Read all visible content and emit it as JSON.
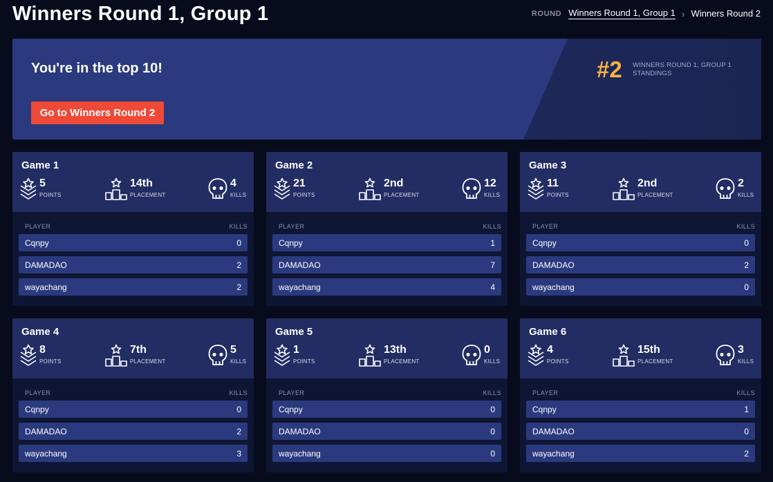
{
  "header": {
    "title": "Winners Round 1, Group 1",
    "breadcrumb_label": "ROUND",
    "breadcrumb_current": "Winners Round 1, Group 1",
    "breadcrumb_next": "Winners Round 2"
  },
  "banner": {
    "title": "You're in the top 10!",
    "button_label": "Go to Winners Round 2",
    "rank": "#2",
    "rank_caption": "WINNERS ROUND 1, GROUP 1 STANDINGS",
    "rank_color": "#f6b343",
    "button_color": "#ef4a38"
  },
  "table_headers": {
    "player": "PLAYER",
    "kills": "KILLS"
  },
  "stat_labels": {
    "points": "POINTS",
    "placement": "PLACEMENT",
    "kills": "KILLS"
  },
  "icons": {
    "points": "chevron-star-icon",
    "placement": "podium-icon",
    "kills": "skull-icon"
  },
  "games": [
    {
      "title": "Game 1",
      "points": "5",
      "placement": "14th",
      "kills": "4",
      "players": [
        {
          "name": "Cqnpy",
          "kills": "0"
        },
        {
          "name": "DAMADAO",
          "kills": "2"
        },
        {
          "name": "wayachang",
          "kills": "2"
        }
      ]
    },
    {
      "title": "Game 2",
      "points": "21",
      "placement": "2nd",
      "kills": "12",
      "players": [
        {
          "name": "Cqnpy",
          "kills": "1"
        },
        {
          "name": "DAMADAO",
          "kills": "7"
        },
        {
          "name": "wayachang",
          "kills": "4"
        }
      ]
    },
    {
      "title": "Game 3",
      "points": "11",
      "placement": "2nd",
      "kills": "2",
      "players": [
        {
          "name": "Cqnpy",
          "kills": "0"
        },
        {
          "name": "DAMADAO",
          "kills": "2"
        },
        {
          "name": "wayachang",
          "kills": "0"
        }
      ]
    },
    {
      "title": "Game 4",
      "points": "8",
      "placement": "7th",
      "kills": "5",
      "players": [
        {
          "name": "Cqnpy",
          "kills": "0"
        },
        {
          "name": "DAMADAO",
          "kills": "2"
        },
        {
          "name": "wayachang",
          "kills": "3"
        }
      ]
    },
    {
      "title": "Game 5",
      "points": "1",
      "placement": "13th",
      "kills": "0",
      "players": [
        {
          "name": "Cqnpy",
          "kills": "0"
        },
        {
          "name": "DAMADAO",
          "kills": "0"
        },
        {
          "name": "wayachang",
          "kills": "0"
        }
      ]
    },
    {
      "title": "Game 6",
      "points": "4",
      "placement": "15th",
      "kills": "3",
      "players": [
        {
          "name": "Cqnpy",
          "kills": "1"
        },
        {
          "name": "DAMADAO",
          "kills": "0"
        },
        {
          "name": "wayachang",
          "kills": "2"
        }
      ]
    }
  ]
}
